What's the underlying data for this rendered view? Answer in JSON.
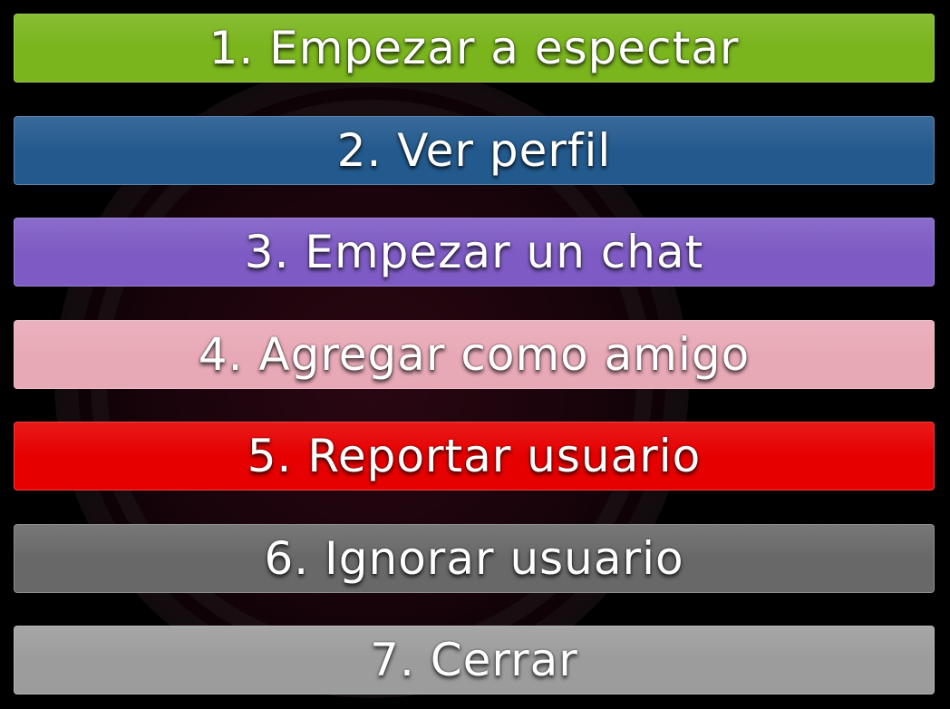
{
  "menu": {
    "items": [
      {
        "label": "1. Empezar a espectar",
        "color": "#7ab51d"
      },
      {
        "label": "2. Ver perfil",
        "color": "#235a8e"
      },
      {
        "label": "3. Empezar un chat",
        "color": "#7e5bc4"
      },
      {
        "label": "4. Agregar como amigo",
        "color": "#e8a9b6"
      },
      {
        "label": "5. Reportar usuario",
        "color": "#e60000"
      },
      {
        "label": "6. Ignorar usuario",
        "color": "#686868"
      },
      {
        "label": "7. Cerrar",
        "color": "#9c9c9c"
      }
    ]
  },
  "background": {
    "color": "#000000",
    "logo_icon": "game-logo-watermark"
  }
}
